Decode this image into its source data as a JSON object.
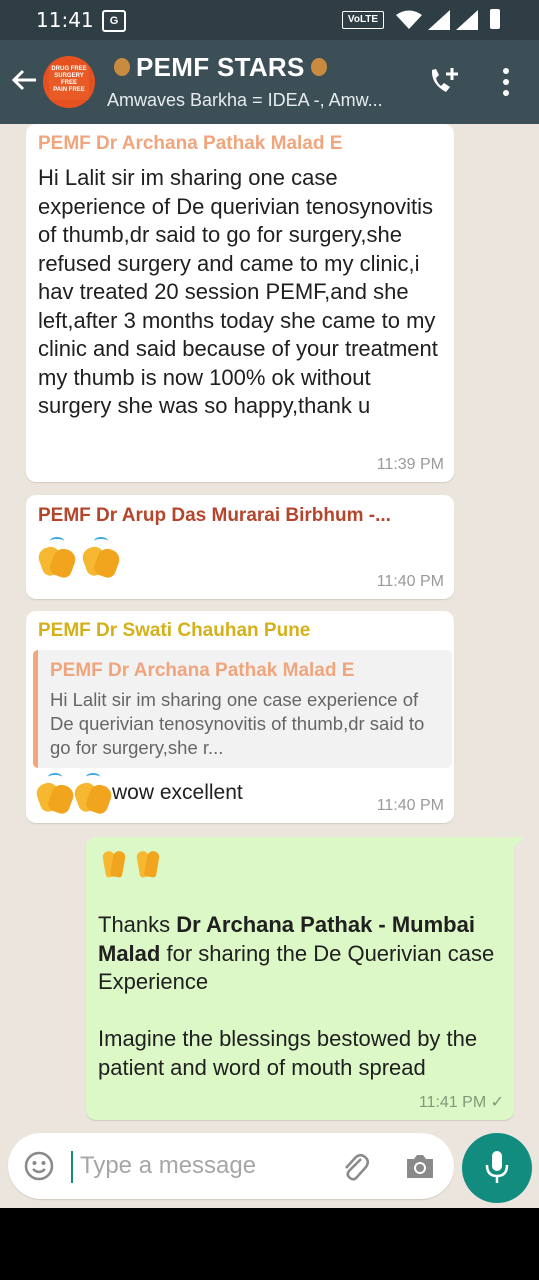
{
  "status_bar": {
    "time": "11:41",
    "app_icon_text": "G",
    "volte": "VoLTE"
  },
  "header": {
    "title": "PEMF STARS",
    "subtitle": "Amwaves Barkha = IDEA -, Amw...",
    "avatar_lines": [
      "DRUG FREE",
      "SURGERY FREE",
      "PAIN FREE"
    ]
  },
  "messages": [
    {
      "sender": "PEMF Dr Archana Pathak Malad E",
      "sender_color": "#f0a57d",
      "text": "Hi Lalit sir im sharing one case experience of De querivian tenosynovitis of thumb,dr said to go for surgery,she refused surgery and came to my clinic,i hav treated 20 session PEMF,and she left,after 3 months today she came to my clinic and said because of your treatment my thumb is now 100% ok without surgery she was so happy,thank u",
      "time": "11:39 PM"
    },
    {
      "sender": "PEMF Dr Arup Das Murarai Birbhum -...",
      "sender_color": "#b5452b",
      "time": "11:40 PM"
    },
    {
      "sender": "PEMF Dr Swati Chauhan Pune",
      "sender_color": "#d4b11a",
      "quote_sender": "PEMF Dr Archana Pathak Malad E",
      "quote_text": "Hi Lalit sir im sharing one case experience of De querivian tenosynovitis of thumb,dr said to go for surgery,she r...",
      "text": "wow excellent",
      "time": "11:40 PM"
    },
    {
      "thanks_prefix": "Thanks ",
      "thanks_name": "Dr Archana Pathak - Mumbai Malad",
      "thanks_suffix": " for sharing the De Querivian case Experience",
      "para2": "Imagine the blessings bestowed by the patient and word of mouth spread",
      "time": "11:41 PM ✓"
    }
  ],
  "composer": {
    "placeholder": "Type a message"
  }
}
